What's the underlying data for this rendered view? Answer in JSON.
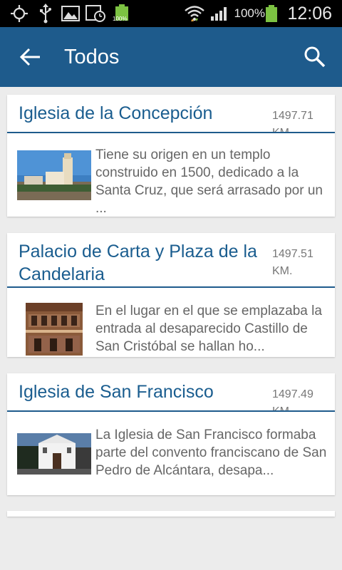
{
  "status_bar": {
    "battery_label": "100%",
    "battery_small_label": "100%",
    "time": "12:06"
  },
  "app_bar": {
    "title": "Todos",
    "back_icon": "arrow-back-icon",
    "search_icon": "search-icon"
  },
  "places": [
    {
      "title": "Iglesia de la Concepción",
      "distance": "1497.71 KM.",
      "description": "Tiene su origen en un templo construido en 1500, dedicado a la Santa Cruz, que será arrasado por un ..."
    },
    {
      "title": "Palacio de Carta y Plaza de la Candelaria",
      "distance": "1497.51 KM.",
      "description": "En el lugar en el que se emplazaba la entrada al desaparecido Castillo de San Cristóbal se hallan ho..."
    },
    {
      "title": "Iglesia de San Francisco",
      "distance": "1497.49 KM.",
      "description": "La Iglesia de San Francisco formaba parte del convento franciscano de San Pedro de Alcántara, desapa..."
    }
  ]
}
